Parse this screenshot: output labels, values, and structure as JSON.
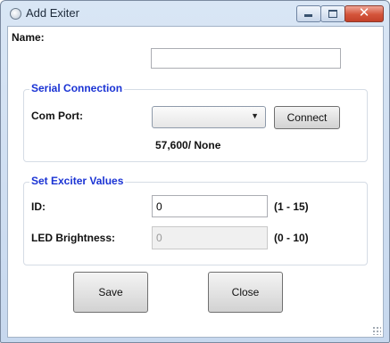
{
  "window": {
    "title": "Add Exiter"
  },
  "form": {
    "name_label": "Name:",
    "name_value": ""
  },
  "serial": {
    "group_title": "Serial Connection",
    "com_port_label": "Com Port:",
    "com_port_value": "",
    "connect_label": "Connect",
    "settings_text": "57,600/ None"
  },
  "exciter": {
    "group_title": "Set Exciter Values",
    "id_label": "ID:",
    "id_value": "0",
    "id_range": "(1 - 15)",
    "led_label": "LED Brightness:",
    "led_value": "0",
    "led_range": "(0 - 10)"
  },
  "buttons": {
    "save_label": "Save",
    "close_label": "Close"
  },
  "icons": {
    "app": "radio-circle-icon",
    "minimize": "minimize-icon",
    "maximize": "maximize-icon",
    "close": "close-icon",
    "dropdown": "chevron-down-icon",
    "resize": "resize-grip-icon"
  },
  "colors": {
    "group_title": "#1a33d4",
    "title_close": "#d3543a"
  }
}
